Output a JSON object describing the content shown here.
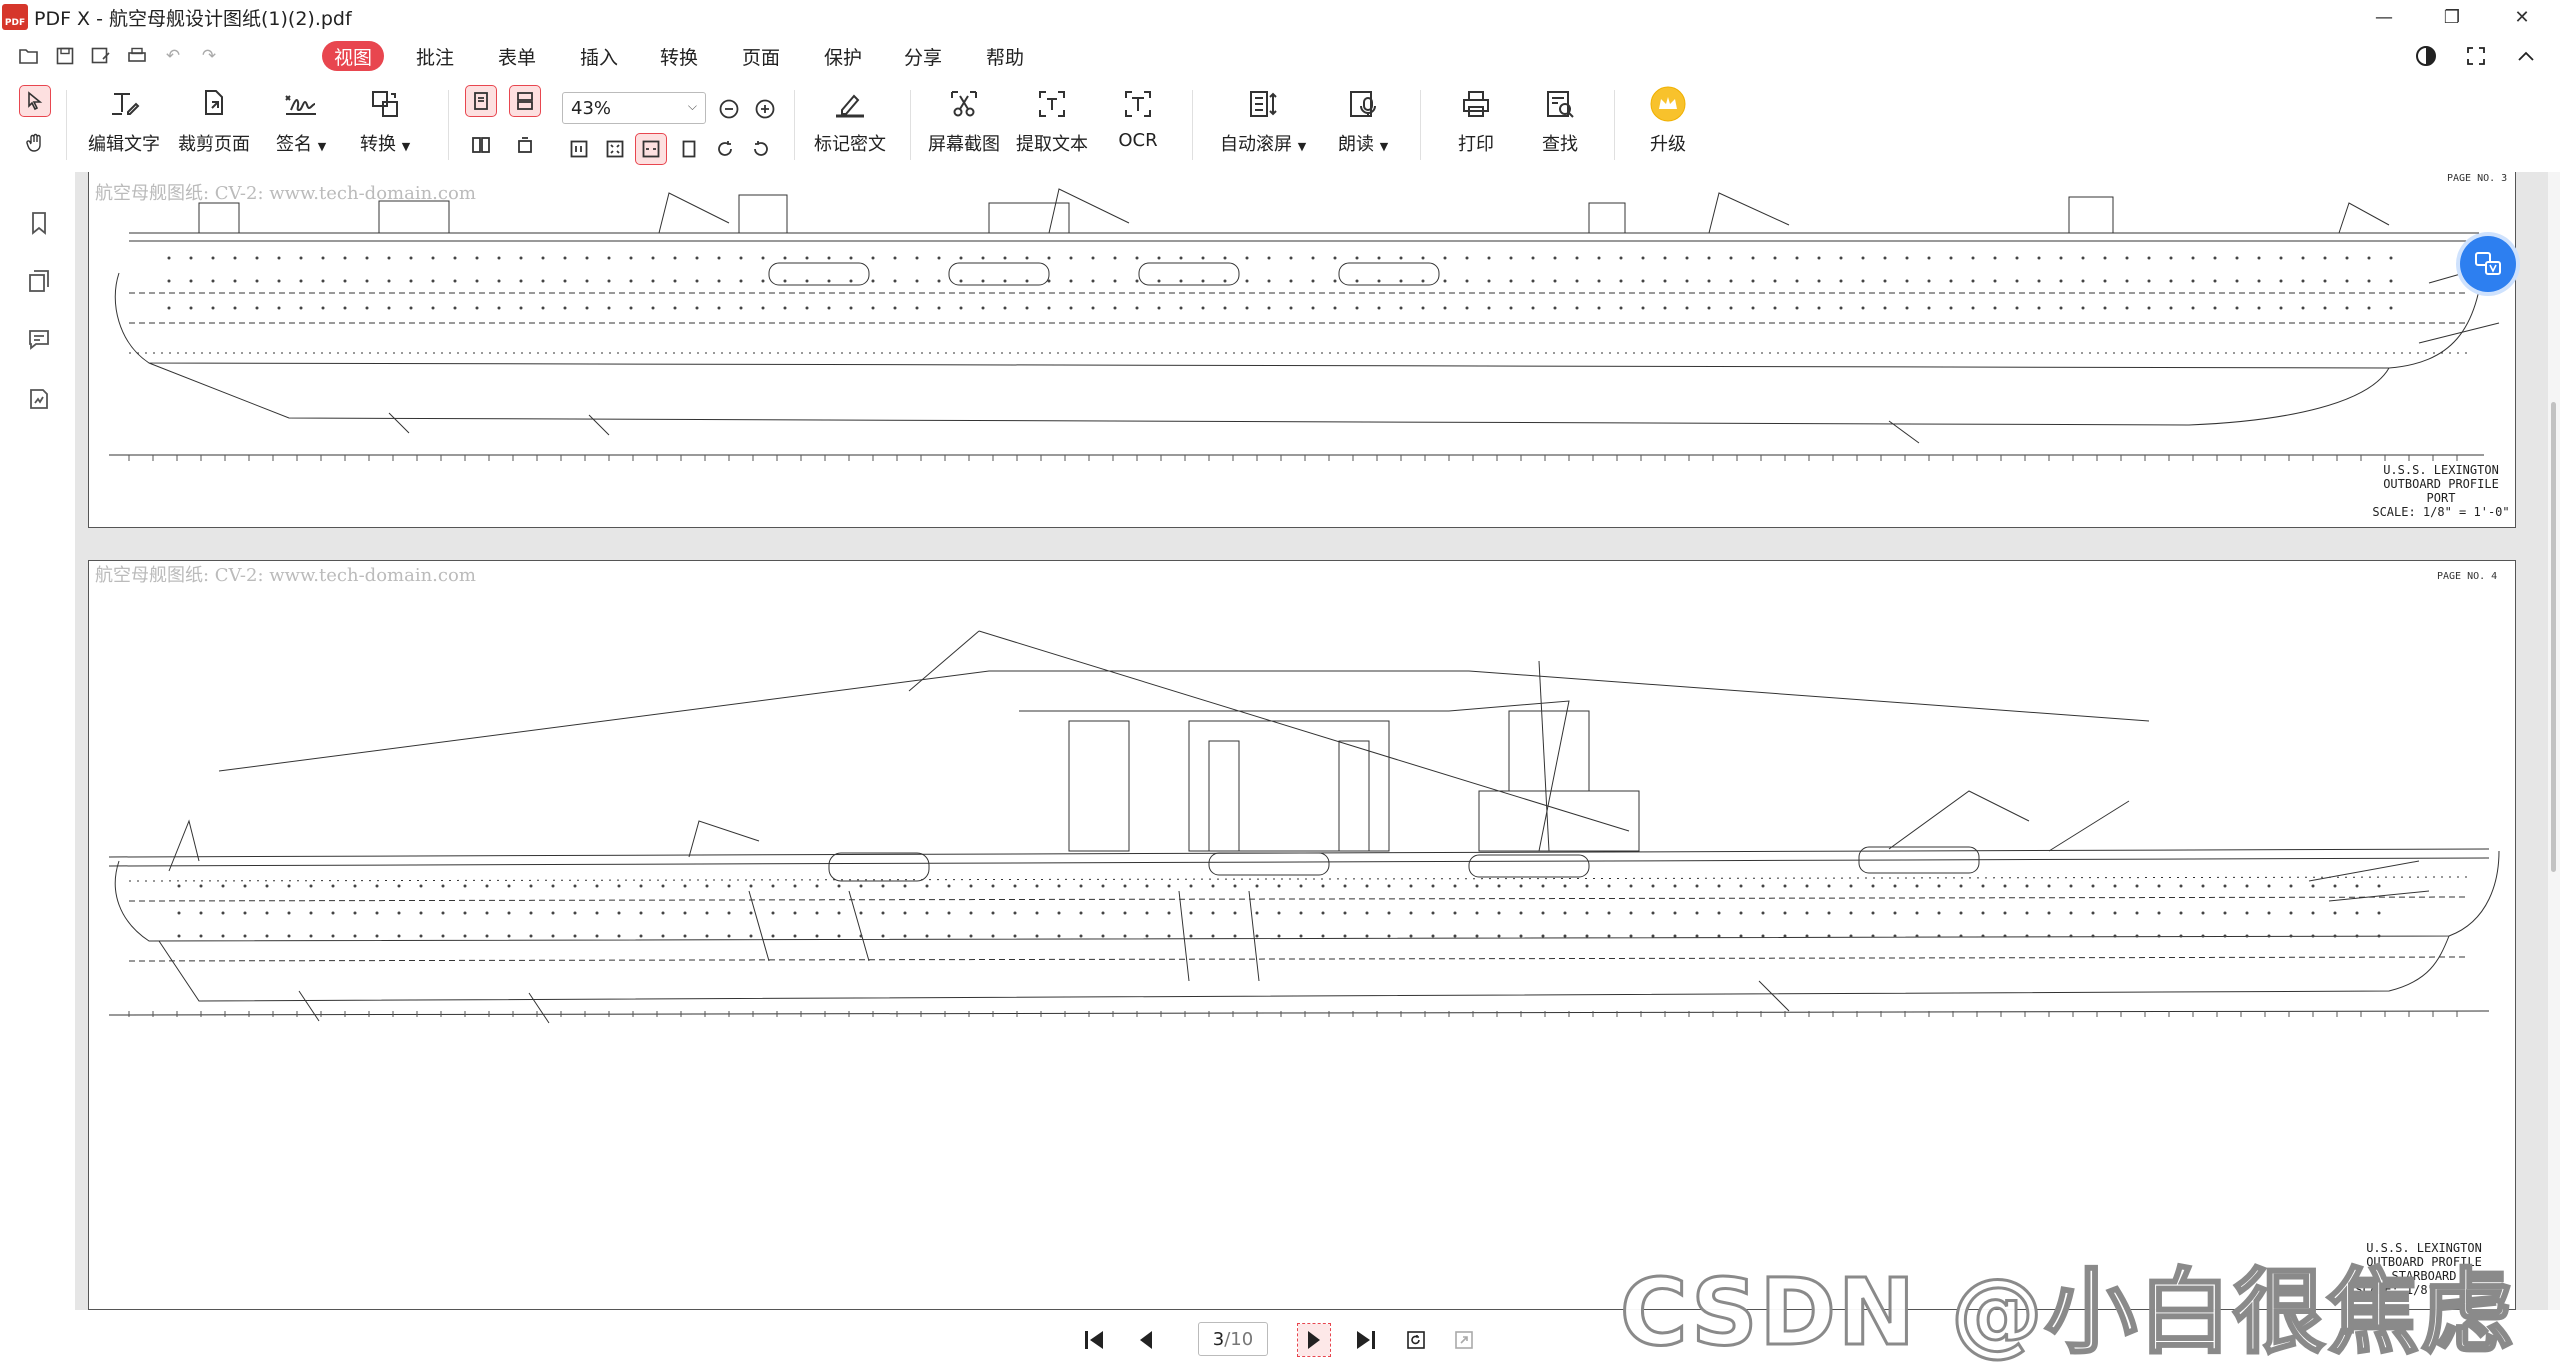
{
  "window": {
    "logo_text": "PDF",
    "title": "PDF X - 航空母舰设计图纸(1)(2).pdf"
  },
  "menu": {
    "tabs": [
      "视图",
      "批注",
      "表单",
      "插入",
      "转换",
      "页面",
      "保护",
      "分享",
      "帮助"
    ],
    "active": "视图"
  },
  "toolbar": {
    "edit_text": "编辑文字",
    "crop_page": "裁剪页面",
    "sign": "签名",
    "convert": "转换",
    "zoom": "43%",
    "mark_redact": "标记密文",
    "screenshot": "屏幕截图",
    "extract_text": "提取文本",
    "ocr": "OCR",
    "auto_scroll": "自动滚屏",
    "read_aloud": "朗读",
    "print": "打印",
    "find": "查找",
    "upgrade": "升级"
  },
  "document": {
    "page3": {
      "watermark": "航空母舰图纸: CV-2: www.tech-domain.com",
      "page_no": "PAGE NO. 3",
      "caption_line1": "U.S.S. LEXINGTON",
      "caption_line2": "OUTBOARD PROFILE PORT",
      "caption_line3": "SCALE: 1/8\" = 1'-0\""
    },
    "page4": {
      "watermark": "航空母舰图纸: CV-2: www.tech-domain.com",
      "page_no": "PAGE NO. 4",
      "caption_line1": "U.S.S. LEXINGTON",
      "caption_line2": "OUTBOARD PROFILE STARBOARD",
      "caption_line3": "SCALE: 1/8\" = 1'-0\""
    }
  },
  "pagination": {
    "current": "3",
    "total": "/10"
  },
  "overlay_watermark": "CSDN @小白很焦虑",
  "colors": {
    "accent": "#e8464f",
    "float_button": "#2d7ff0",
    "doc_bg": "#e6e6e6"
  }
}
